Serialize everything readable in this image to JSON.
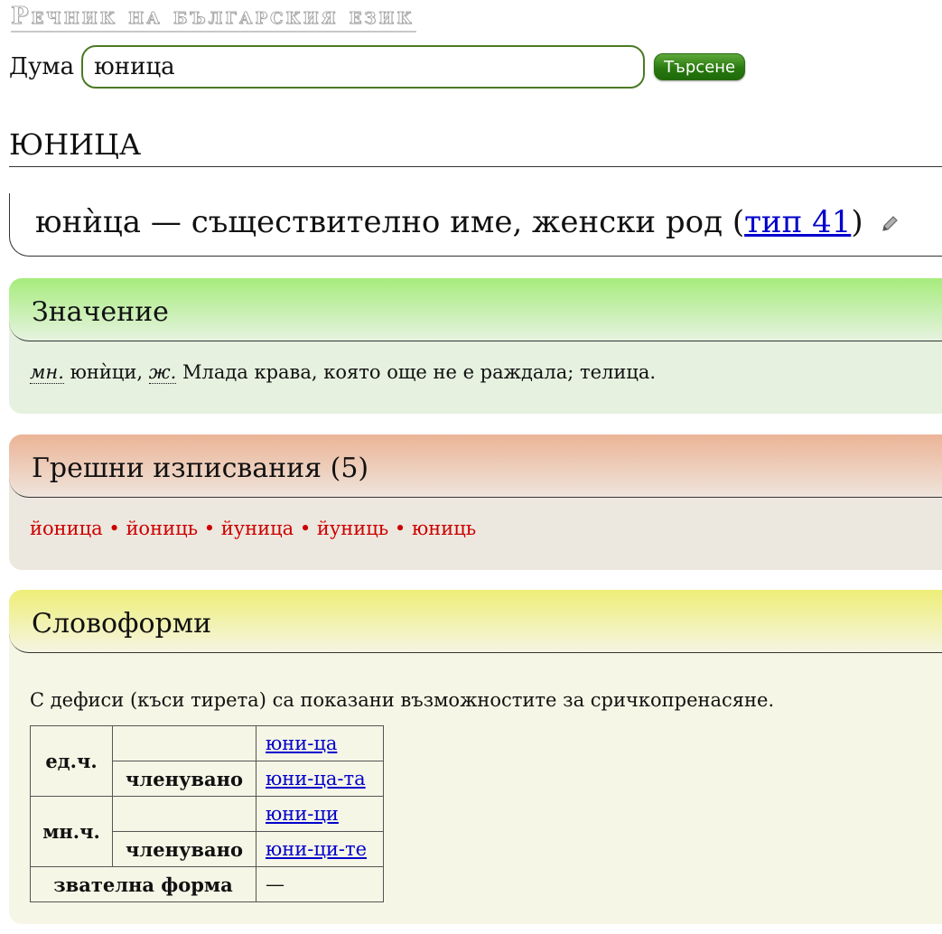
{
  "site": {
    "title": "Речник на българския език"
  },
  "search": {
    "label": "Дума",
    "value": "юница",
    "button_label": "Търсене"
  },
  "word": {
    "heading": "ЮНИЦА",
    "headword": "юнѝца",
    "dash": "—",
    "description": "съществително име, женски род",
    "type_open": "(",
    "type_link": "тип 41",
    "type_close": ")"
  },
  "meaning": {
    "title": "Значение",
    "abbr_plural": "мн.",
    "plural_form": "юнѝци",
    "abbr_gender": "ж.",
    "definition": "Млада крава, която още не е раждала; телица."
  },
  "misspellings": {
    "title": "Грешни изписвания (5)",
    "items": [
      "йоница",
      "йониць",
      "йуница",
      "йуниць",
      "юниць"
    ],
    "separator": "•"
  },
  "wordforms": {
    "title": "Словоформи",
    "note": "С дефиси (къси тирета) са показани възможностите за сричкопренасяне.",
    "singular_label": "ед.ч.",
    "plural_label": "мн.ч.",
    "definite_label": "членувано",
    "vocative_label": "звателна форма",
    "singular": "юни-ца",
    "singular_definite": "юни-ца-та",
    "plural": "юни-ци",
    "plural_definite": "юни-ци-те",
    "vocative": "—"
  },
  "colors": {
    "input_border": "#4c7a24",
    "button": "#2a7a10",
    "link": "#0000cc",
    "misspelling": "#cc0000",
    "meaning_header": "#a6ec7c",
    "misspell_header": "#ebb496",
    "forms_header": "#eeee78"
  },
  "icons": {
    "edit": "pencil-icon"
  }
}
